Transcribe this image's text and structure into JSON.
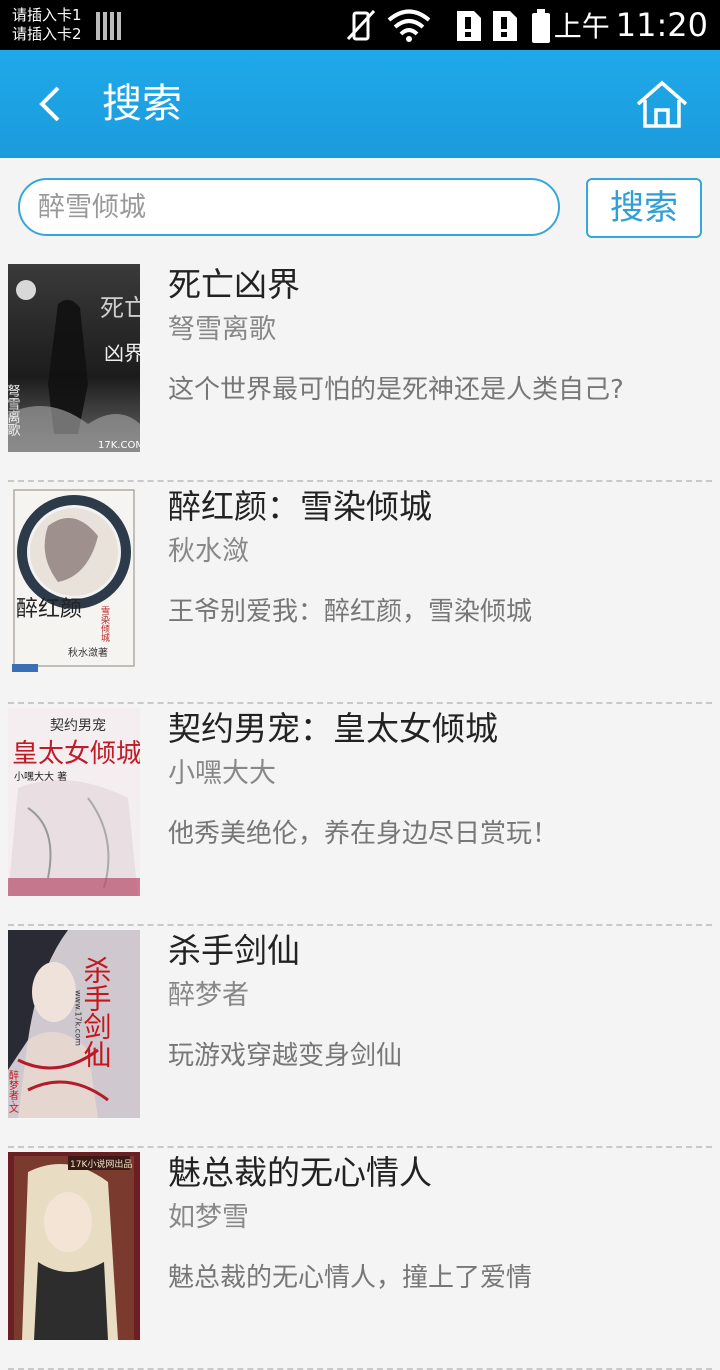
{
  "status_bar": {
    "sim1": "请插入卡1",
    "sim2": "请插入卡2",
    "ampm": "上午",
    "time": "11:20"
  },
  "app_bar": {
    "title": "搜索"
  },
  "search": {
    "placeholder": "醉雪倾城",
    "value": "",
    "button_label": "搜索"
  },
  "results": [
    {
      "title": "死亡凶界",
      "author": "弩雪离歌",
      "description": "这个世界最可怕的是死神还是人类自己?",
      "cover_text": [
        "死亡",
        "凶界",
        "弩雪离歌",
        "17K.COM"
      ]
    },
    {
      "title": "醉红颜：雪染倾城",
      "author": "秋水潋",
      "description": "王爷别爱我：醉红颜，雪染倾城",
      "cover_text": [
        "醉红颜",
        "雪染倾城",
        "秋水潋著"
      ]
    },
    {
      "title": "契约男宠：皇太女倾城",
      "author": "小嘿大大",
      "description": "他秀美绝伦，养在身边尽日赏玩！",
      "cover_text": [
        "契约男宠",
        "皇太女倾城",
        "小嘿大大 著"
      ]
    },
    {
      "title": "杀手剑仙",
      "author": "醉梦者",
      "description": "玩游戏穿越变身剑仙",
      "cover_text": [
        "杀手剑仙",
        "www.17k.com",
        "醉梦者·文"
      ]
    },
    {
      "title": "魅总裁的无心情人",
      "author": "如梦雪",
      "description": "魅总裁的无心情人，撞上了爱情",
      "cover_text": [
        "17K小说网出品"
      ]
    }
  ]
}
